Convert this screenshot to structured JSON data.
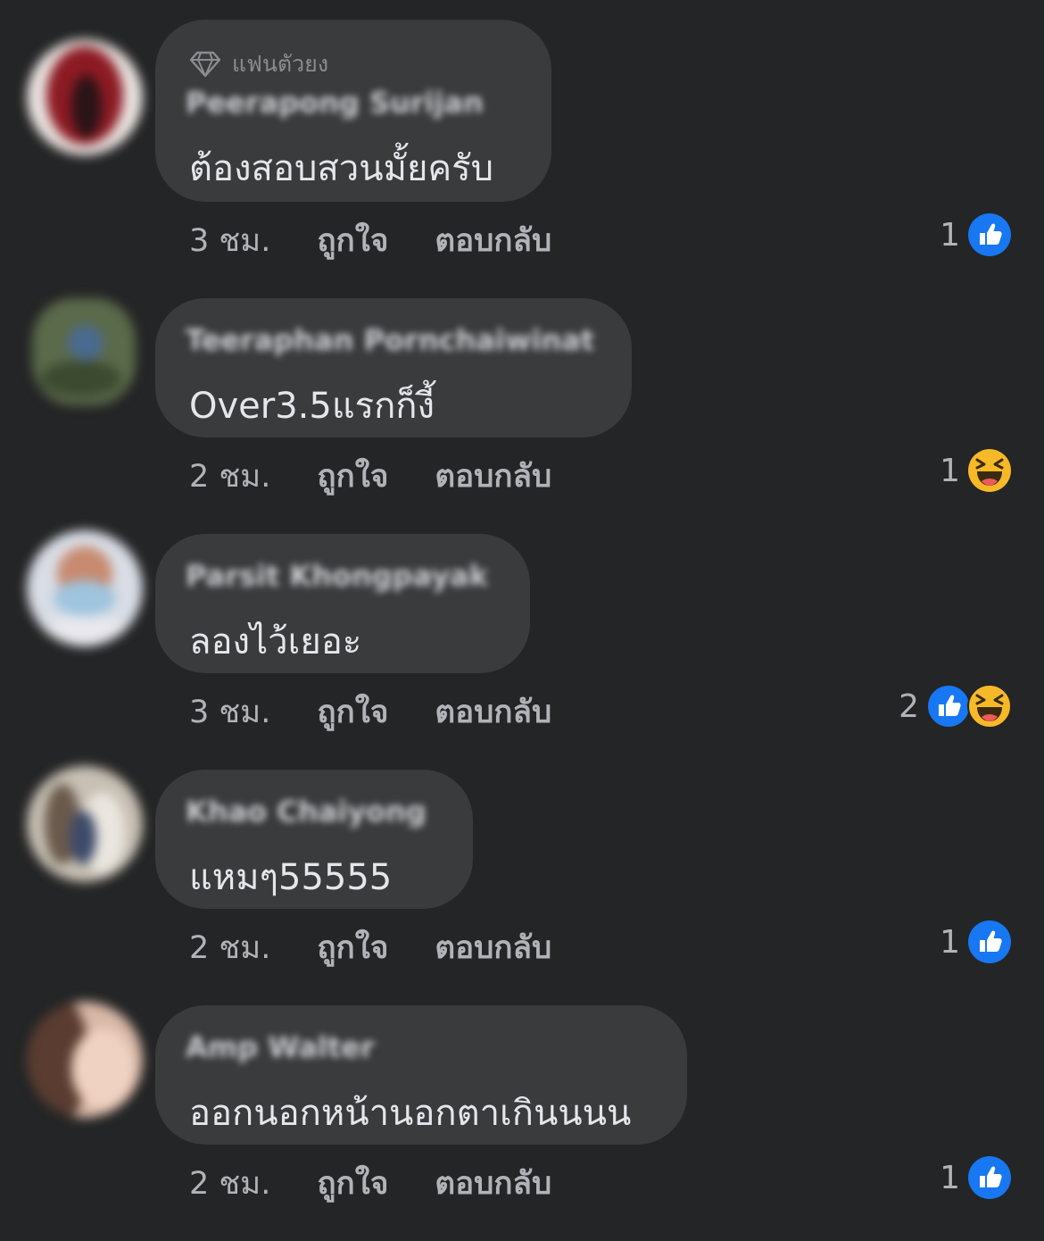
{
  "badge_label": "แฟนตัวยง",
  "like_label": "ถูกใจ",
  "reply_label": "ตอบกลับ",
  "colors": {
    "background": "#242526",
    "bubble": "#3a3b3c",
    "like_blue": "#1877f2",
    "haha_yellow": "#f7b928"
  },
  "comments": [
    {
      "name": "Peerapong Surijan",
      "text": "ต้องสอบสวนมั้ยครับ",
      "time": "3 ชม.",
      "reaction_count": "1",
      "reactions": [
        "like-icon"
      ],
      "has_badge": true
    },
    {
      "name": "Teeraphan Pornchaiwinat",
      "text": "Over3.5แรกก็งี้",
      "time": "2 ชม.",
      "reaction_count": "1",
      "reactions": [
        "haha-icon"
      ],
      "has_badge": false
    },
    {
      "name": "Parsit Khongpayak",
      "text": "ลองไว้เยอะ",
      "time": "3 ชม.",
      "reaction_count": "2",
      "reactions": [
        "like-icon",
        "haha-icon"
      ],
      "has_badge": false
    },
    {
      "name": "Khao Chaiyong",
      "text": "แหมๆ55555",
      "time": "2 ชม.",
      "reaction_count": "1",
      "reactions": [
        "like-icon"
      ],
      "has_badge": false
    },
    {
      "name": "Amp Walter",
      "text": "ออกนอกหน้านอกตาเกินนนน",
      "time": "2 ชม.",
      "reaction_count": "1",
      "reactions": [
        "like-icon"
      ],
      "has_badge": false
    }
  ]
}
